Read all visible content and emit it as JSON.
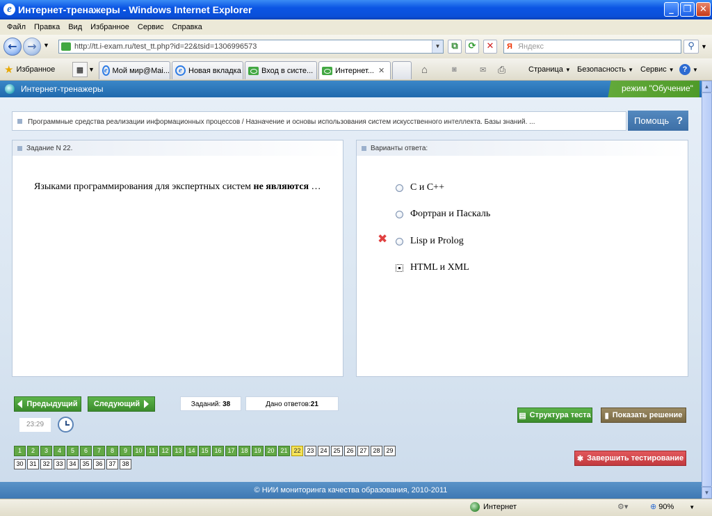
{
  "window": {
    "title": "Интернет-тренажеры - Windows Internet Explorer"
  },
  "menubar": {
    "items": [
      "Файл",
      "Правка",
      "Вид",
      "Избранное",
      "Сервис",
      "Справка"
    ]
  },
  "address": {
    "url": "http://tt.i-exam.ru/test_tt.php?id=22&tsid=1306996573",
    "search_placeholder": "Яндекс"
  },
  "toolbar": {
    "favorites_label": "Избранное",
    "tabs": [
      "Мой мир@Mai...",
      "Новая вкладка",
      "Вход в систе...",
      "Интернет..."
    ],
    "page_label": "Страница",
    "security_label": "Безопасность",
    "tools_label": "Сервис"
  },
  "header": {
    "title": "Интернет-тренажеры",
    "mode": "режим \"Обучение\""
  },
  "breadcrumb": "Программные средства реализации информационных процессов / Назначение и основы использования систем искусственного интеллекта. Базы знаний. ...",
  "help_label": "Помощь",
  "help_glyph": "?",
  "task": {
    "title": "Задание N 22.",
    "question_main": "Языками программирования для экспертных систем ",
    "question_bold": "не являются",
    "question_end": " …"
  },
  "answers": {
    "title": "Варианты ответа:",
    "options": [
      "C и C++",
      "Фортран и Паскаль",
      "Lisp и Prolog",
      "HTML и XML"
    ],
    "selected_index": 3,
    "wrong_index": 2,
    "wrong_mark": "✖"
  },
  "nav": {
    "prev_label": "Предыдущий",
    "next_label": "Следующий",
    "tasks_label": "Заданий:",
    "tasks_count": "38",
    "answered_label": "Дано ответов:",
    "answered_count": "21",
    "timer": "23:29",
    "structure_label": "Структура теста",
    "solution_label": "Показать решение",
    "finish_label": "Завершить тестирование"
  },
  "questions": {
    "total": 38,
    "answered_upto": 21,
    "current": 22
  },
  "footer": "© НИИ мониторинга качества образования, 2010-2011",
  "status": {
    "zone": "Интернет",
    "zoom": "90%"
  },
  "colors": {
    "header_blue": "#2c77bb",
    "done_green": "#62a846",
    "current_yellow": "#f5e35a",
    "finish_red": "#d24a4e"
  }
}
